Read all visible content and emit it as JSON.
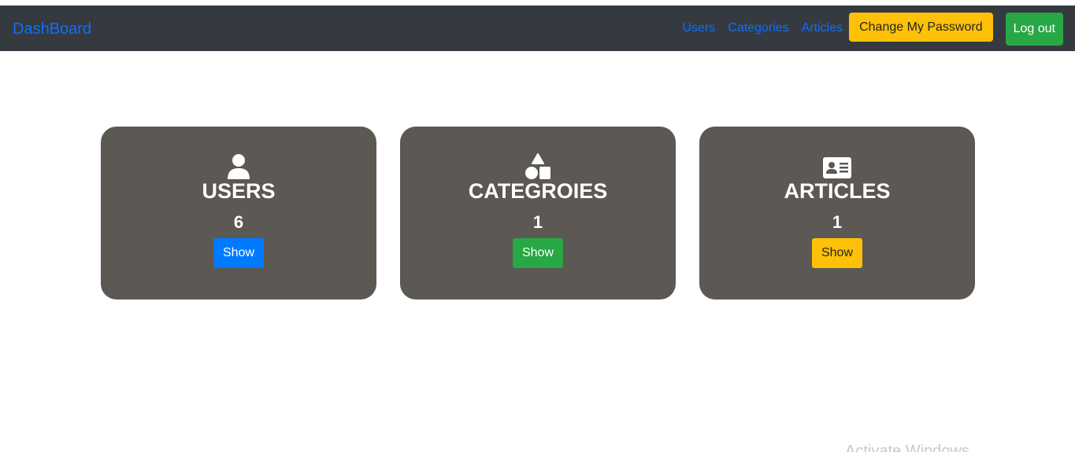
{
  "navbar": {
    "brand": "DashBoard",
    "links": {
      "users": "Users",
      "categories": "Categories",
      "articles": "Articles"
    },
    "change_password_label": "Change My Password",
    "logout_label": "Log out"
  },
  "cards": [
    {
      "icon": "user-icon",
      "title": "USERS",
      "count": "6",
      "button_label": "Show",
      "button_color": "#007bff"
    },
    {
      "icon": "shapes-icon",
      "title": "CATEGROIES",
      "count": "1",
      "button_label": "Show",
      "button_color": "#28a745"
    },
    {
      "icon": "id-card-icon",
      "title": "ARTICLES",
      "count": "1",
      "button_label": "Show",
      "button_color": "#ffc107"
    }
  ],
  "watermark": "Activate Windows",
  "colors": {
    "navbar_bg": "#343a40",
    "card_bg": "#5c5853",
    "link": "#0d6efd",
    "warning": "#ffc107",
    "success": "#28a745",
    "primary": "#007bff"
  }
}
